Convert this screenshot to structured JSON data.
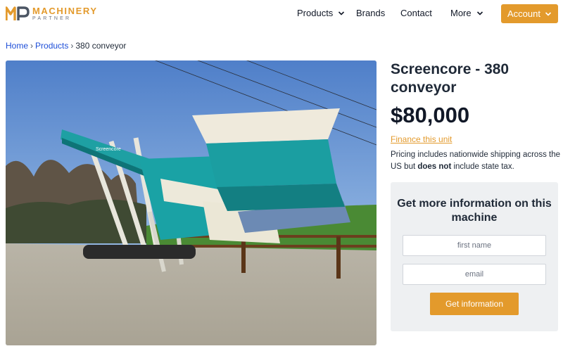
{
  "brand": {
    "logo_mark": "MP",
    "name": "MACHINERY",
    "tagline": "PARTNER",
    "accent_color": "#e39a2c"
  },
  "nav": {
    "products": "Products",
    "brands": "Brands",
    "contact": "Contact",
    "more": "More",
    "account": "Account"
  },
  "breadcrumb": {
    "home": "Home",
    "products": "Products",
    "current": "380 conveyor",
    "separator": "›"
  },
  "product": {
    "title": "Screencore - 380 conveyor",
    "price": "$80,000",
    "finance_link": "Finance this unit",
    "pricing_note_before": "Pricing includes nationwide shipping across the US but ",
    "pricing_note_bold": "does not",
    "pricing_note_after": " include state tax.",
    "image_label": "Screencore"
  },
  "info_form": {
    "heading": "Get more information on this machine",
    "first_name_placeholder": "first name",
    "email_placeholder": "email",
    "submit_label": "Get information"
  },
  "icons": {
    "products_chevron": "chevron-down-icon",
    "more_chevron": "chevron-down-icon",
    "account_chevron": "chevron-down-icon"
  }
}
